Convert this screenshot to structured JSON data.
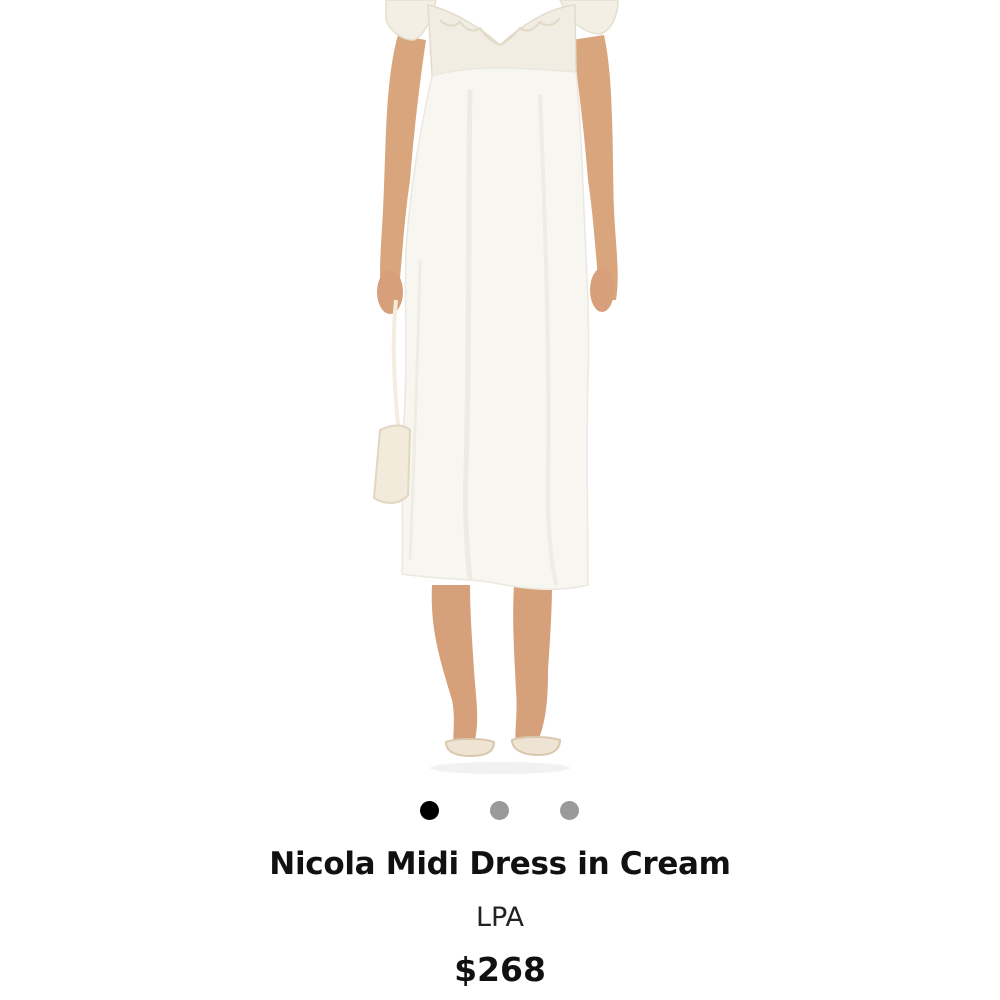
{
  "product": {
    "title": "Nicola Midi Dress in Cream",
    "brand": "LPA",
    "price": "$268"
  },
  "carousel": {
    "total_slides": 3,
    "active_index": 0,
    "active_color": "#000000",
    "inactive_color": "#9a9a9a"
  },
  "colors": {
    "background": "#ffffff",
    "dress": "#f7f6f1",
    "lace": "#f1ede2",
    "skin": "#d9a57c",
    "bag": "#f2eadb"
  }
}
